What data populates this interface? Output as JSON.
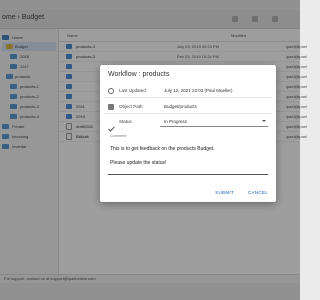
{
  "window": {
    "title": "ome › Budget"
  },
  "tree": [
    {
      "label": "Home"
    },
    {
      "label": "Budget"
    },
    {
      "label": "2018"
    },
    {
      "label": "2017"
    },
    {
      "label": "products"
    },
    {
      "label": "products-1"
    },
    {
      "label": "products-2"
    },
    {
      "label": "products-3"
    },
    {
      "label": "products-4"
    },
    {
      "label": "Private"
    },
    {
      "label": "Incoming"
    },
    {
      "label": "Inventar"
    }
  ],
  "list": {
    "col_name": "Name",
    "col_modified": "Modified",
    "rows": [
      {
        "name": "products-4",
        "date": "July 23, 2019 09:24 PM",
        "user": "ipael@ipael"
      },
      {
        "name": "products-3",
        "date": "Feb 23, 2019 10:24 PM",
        "user": "ipael@ipael"
      },
      {
        "name": "",
        "date": "",
        "user": "ipael@ipael"
      },
      {
        "name": "",
        "date": "",
        "user": "ipael@ipael"
      },
      {
        "name": "",
        "date": "",
        "user": "ipael@ipael"
      },
      {
        "name": "",
        "date": "",
        "user": "ipael@ipael"
      },
      {
        "name": "2021",
        "date": "",
        "user": "ipael@ipael"
      },
      {
        "name": "2019",
        "date": "",
        "user": "ipael@ipael"
      },
      {
        "name": "draft2020",
        "date": "",
        "user": "ipael@ipael"
      },
      {
        "name": "Billkiaft",
        "date": "",
        "user": "ipael@ipael"
      }
    ]
  },
  "footer": {
    "support": "For support, contact us at support@ipaelonline.com"
  },
  "modal": {
    "title": "Workflow : products",
    "fields": [
      {
        "label": "Last Updated",
        "value": "July 12, 2021 23:03 (Paul Mueller)"
      },
      {
        "label": "Object Path",
        "value": "Budget/products"
      },
      {
        "label": "Status",
        "value": "In Progress"
      }
    ],
    "comment_label": "Comment",
    "comment_lines": [
      "This is to get feedback on the products Budget.",
      "Please update the status!"
    ],
    "submit_label": "SUBMIT",
    "cancel_label": "CANCEL"
  },
  "colors": {
    "accent": "#1a5fb4",
    "folder": "#5b9bd5",
    "overlay": "rgba(0,0,0,0.38)"
  }
}
